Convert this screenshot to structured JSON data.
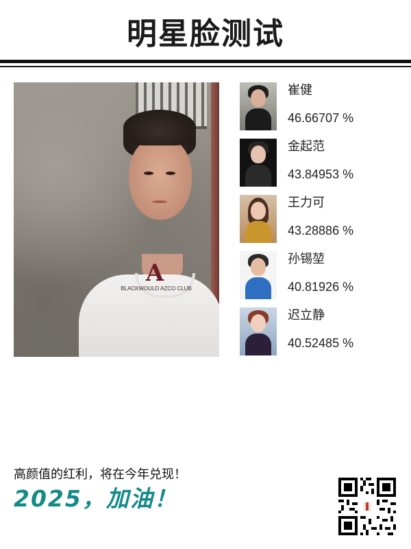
{
  "header": {
    "title": "明星脸测试"
  },
  "photo": {
    "shirt_letter": "A",
    "shirt_text": "BLACKWOULD AZCO CLUB"
  },
  "matches": [
    {
      "name": "崔健",
      "score": "46.66707 %",
      "thumb": "man-with-guitar"
    },
    {
      "name": "金起范",
      "score": "43.84953 %",
      "thumb": "young-man-portrait"
    },
    {
      "name": "王力可",
      "score": "43.28886 %",
      "thumb": "woman-portrait"
    },
    {
      "name": "孙锡堃",
      "score": "40.81926 %",
      "thumb": "boy-sitting"
    },
    {
      "name": "迟立静",
      "score": "40.52485 %",
      "thumb": "woman-floral-dress"
    }
  ],
  "footer": {
    "slogan": "高颜值的红利，将在今年兑现！",
    "cheer": "2025，加油！"
  },
  "colors": {
    "accent": "#138a8a",
    "text": "#222222",
    "rule": "#111111"
  }
}
